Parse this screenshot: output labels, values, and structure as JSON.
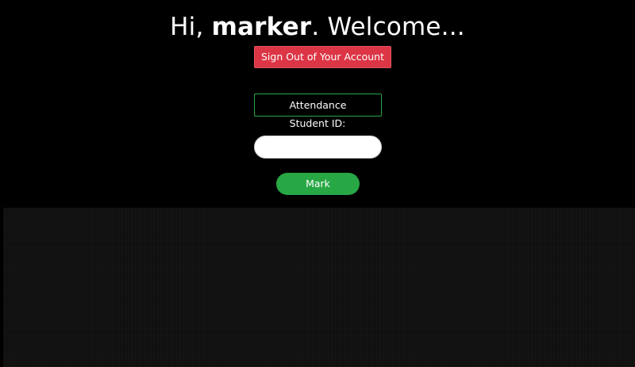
{
  "header": {
    "greeting_prefix": "Hi, ",
    "username": "marker",
    "greeting_suffix": ". Welcome..."
  },
  "account": {
    "sign_out_label": "Sign Out of Your Account",
    "sign_out_color": "#dc3545"
  },
  "attendance": {
    "title": "Attendance",
    "student_id_label": "Student ID:",
    "student_id_value": "",
    "mark_label": "Mark",
    "accent_color": "#28a745"
  }
}
